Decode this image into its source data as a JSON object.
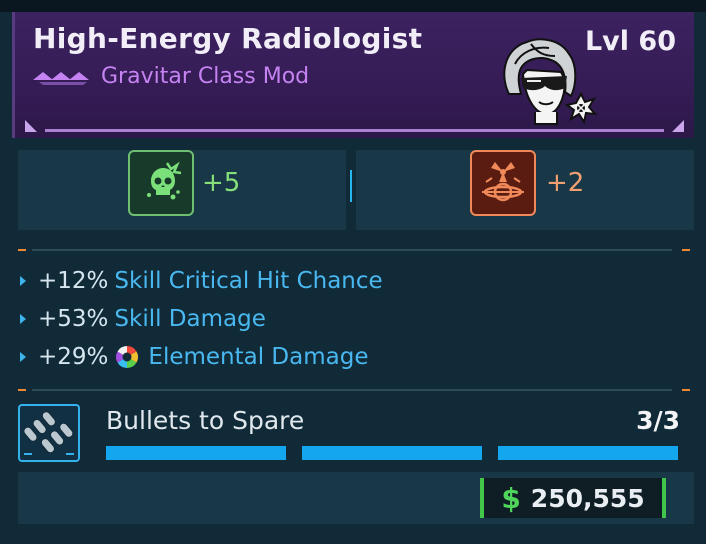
{
  "item": {
    "name": "High-Energy Radiologist",
    "type": "Gravitar Class Mod",
    "level": "Lvl 60",
    "rarity_color": "#c583f2"
  },
  "skills": [
    {
      "icon": "green-skull-skill-icon",
      "bonus": "+5",
      "color": "#86e07a"
    },
    {
      "icon": "radiation-skill-icon",
      "bonus": "+2",
      "color": "#f0a070"
    }
  ],
  "stats": [
    {
      "value": "+12%",
      "label": "Skill Critical Hit Chance",
      "icon": null
    },
    {
      "value": "+53%",
      "label": "Skill Damage",
      "icon": null
    },
    {
      "value": "+29%",
      "label": "Elemental Damage",
      "icon": "elemental-icon"
    }
  ],
  "anointment": {
    "name": "Bullets to Spare",
    "count": "3/3",
    "segments_filled": 3,
    "segments_total": 3
  },
  "price": {
    "currency_symbol": "$",
    "amount": "250,555"
  },
  "colors": {
    "accent_blue": "#14a6ee",
    "separator_orange": "#f08a30",
    "money_green": "#42c64a"
  }
}
